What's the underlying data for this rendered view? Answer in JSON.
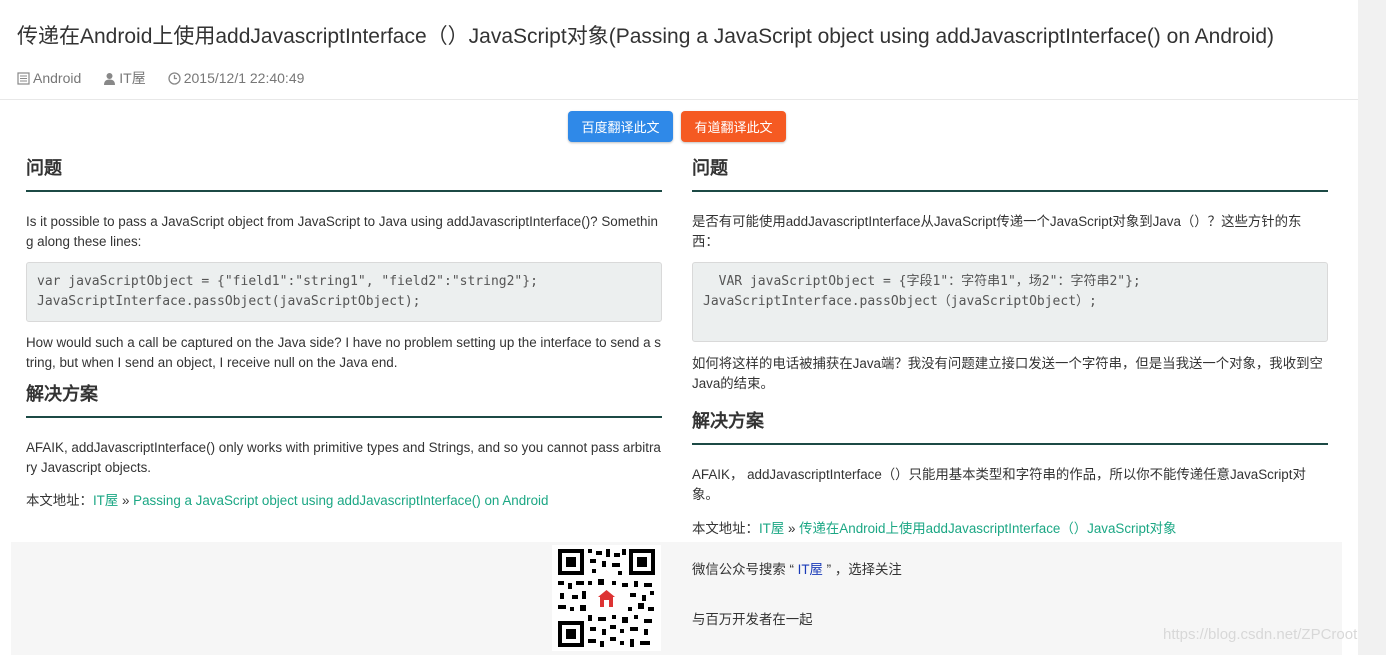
{
  "page": {
    "title": "传递在Android上使用addJavascriptInterface（）JavaScript对象(Passing a JavaScript object using addJavascriptInterface() on Android)",
    "meta": {
      "category": "Android",
      "author": "IT屋",
      "datetime": "2015/12/1 22:40:49"
    }
  },
  "translate": {
    "baidu_label": "百度翻译此文",
    "youdao_label": "有道翻译此文"
  },
  "left": {
    "question_heading": "问题",
    "question_p1": "Is it possible to pass a JavaScript object from JavaScript to Java using addJavascriptInterface()? Something along these lines:",
    "code": "var javaScriptObject = {\"field1\":\"string1\", \"field2\":\"string2\"};\nJavaScriptInterface.passObject(javaScriptObject);",
    "question_p2": "How would such a call be captured on the Java side? I have no problem setting up the interface to send a string, but when I send an object, I receive null on the Java end.",
    "answer_heading": "解决方案",
    "answer_p1": "AFAIK, addJavascriptInterface() only works with primitive types and Strings, and so you cannot pass arbitrary Javascript objects.",
    "source_label": "本文地址：",
    "source_site": "IT屋",
    "source_sep": " » ",
    "source_link": "Passing a JavaScript object using addJavascriptInterface() on Android"
  },
  "right": {
    "question_heading": "问题",
    "question_p1": "是否有可能使用addJavascriptInterface从JavaScript传递一个JavaScript对象到Java（）？这些方针的东西：",
    "code": "  VAR javaScriptObject = {字段1\"：字符串1\"，场2\"：字符串2\"};\nJavaScriptInterface.passObject（javaScriptObject）;",
    "question_p2": "如何将这样的电话被捕获在Java端？我没有问题建立接口发送一个字符串，但是当我送一个对象，我收到空Java的结束。",
    "answer_heading": "解决方案",
    "answer_p1": "AFAIK， addJavascriptInterface（）只能用基本类型和字符串的作品，所以你不能传递任意JavaScript对象。",
    "source_label": "本文地址：",
    "source_site": "IT屋",
    "source_sep": " » ",
    "source_link": "传递在Android上使用addJavascriptInterface（）JavaScript对象"
  },
  "footer": {
    "wechat_prefix": "微信公众号搜索 “ ",
    "wechat_brand": "IT屋",
    "wechat_suffix": " ” ，选择关注",
    "slogan": "与百万开发者在一起",
    "qr_icon": "qr-code-icon"
  },
  "watermark": "https://blog.csdn.net/ZPCroot",
  "colors": {
    "baidu": "#2f89e8",
    "youdao": "#f55a22",
    "link": "#1ba784",
    "heading_rule": "#1c4a45"
  }
}
